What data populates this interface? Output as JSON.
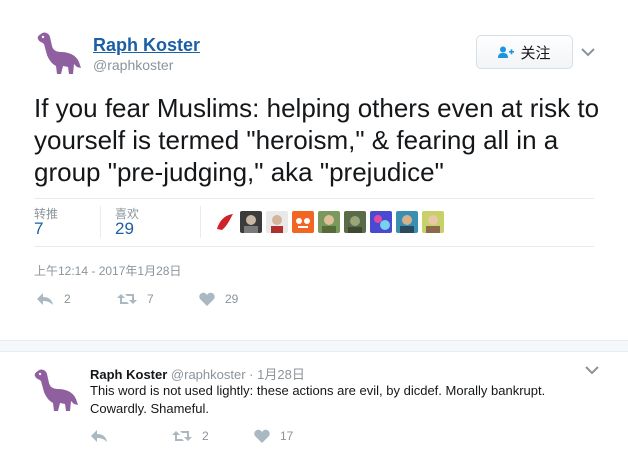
{
  "main_tweet": {
    "author_name": "Raph Koster",
    "author_handle": "@raphkoster",
    "follow_label": "关注",
    "text": "If you fear Muslims: helping others even at risk to yourself is termed \"heroism,\" & fearing all in a group \"pre-judging,\" aka \"prejudice\"",
    "retweets_label": "转推",
    "retweets_value": "7",
    "likes_label": "喜欢",
    "likes_value": "29",
    "timestamp": "上午12:14 - 2017年1月28日",
    "actions": {
      "reply_count": "2",
      "retweet_count": "7",
      "like_count": "29"
    },
    "liker_avatars": [
      "liker-1",
      "liker-2",
      "liker-3",
      "liker-4",
      "liker-5",
      "liker-6",
      "liker-7",
      "liker-8",
      "liker-9"
    ]
  },
  "reply_tweet": {
    "author_name": "Raph Koster",
    "author_handle": "@raphkoster",
    "separator": "·",
    "date": "1月28日",
    "text": "This word is not used lightly: these actions are evil, by dicdef. Morally bankrupt. Cowardly. Shameful.",
    "actions": {
      "retweet_count": "2",
      "like_count": "17"
    }
  },
  "colors": {
    "link_blue": "#1b5fa5",
    "muted": "#8a949c",
    "avatar_purple": "#8f5f9f",
    "heart": "#aab8c2"
  },
  "icons": [
    "dinosaur-avatar-icon",
    "follow-user-icon",
    "chevron-down-icon",
    "reply-icon",
    "retweet-icon",
    "heart-icon"
  ]
}
